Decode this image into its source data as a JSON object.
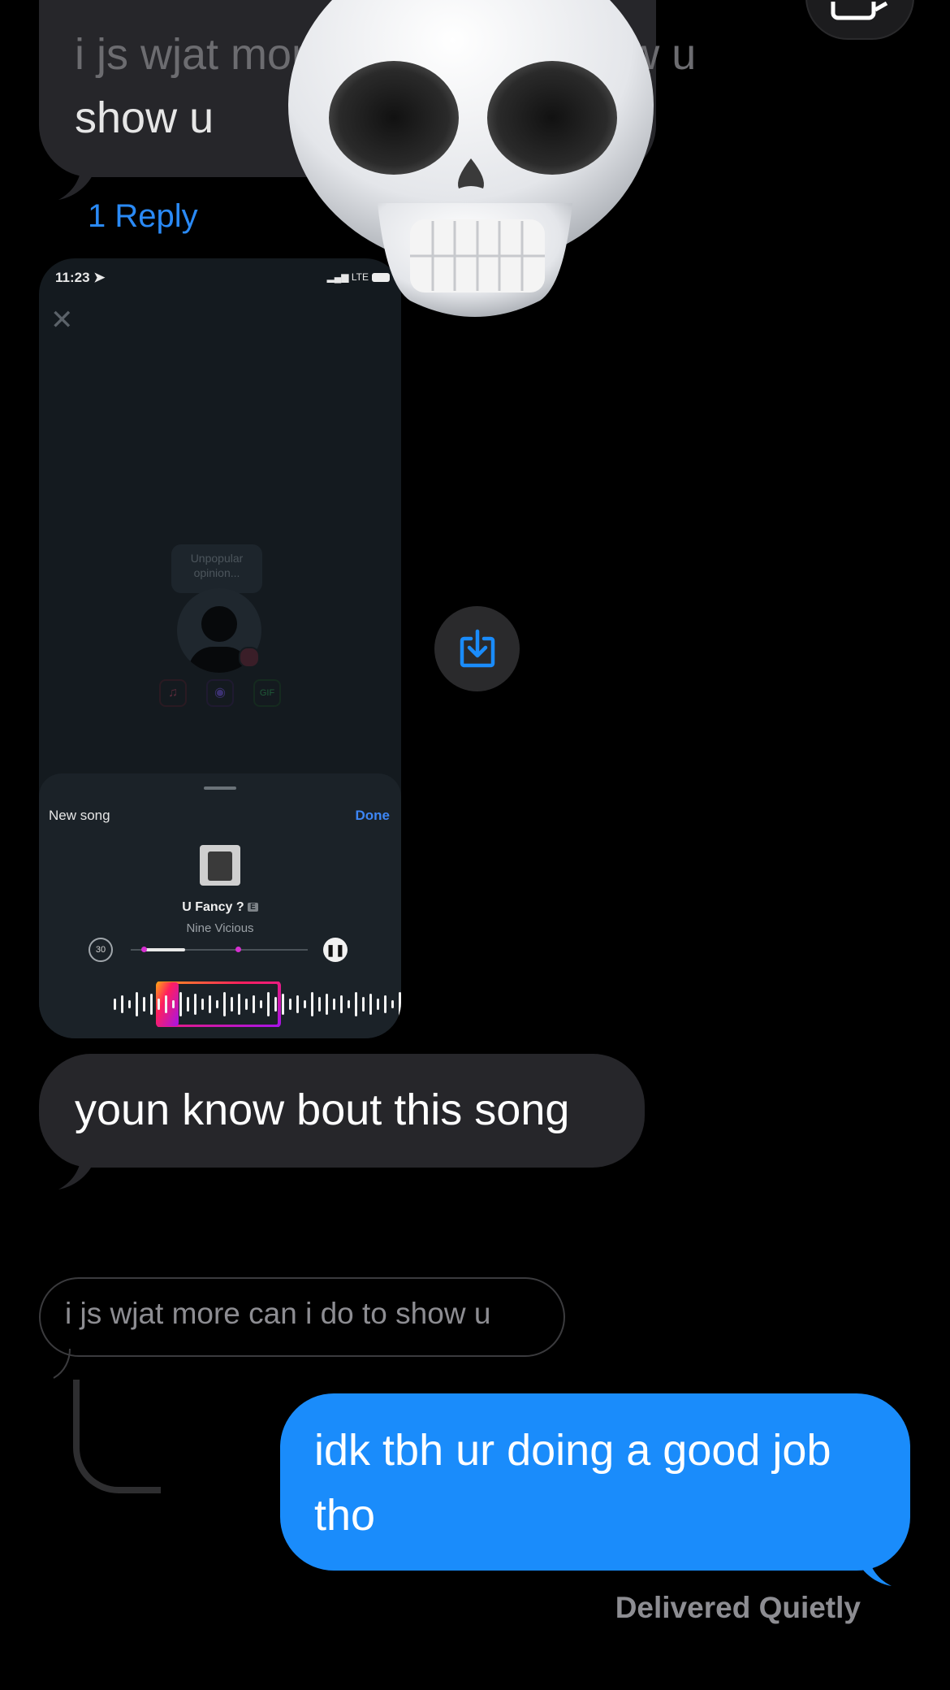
{
  "thread": {
    "clipped_message": {
      "line1": "i js wjat more can i do to show u",
      "line2": "show u"
    },
    "reply_count_label": "1 Reply",
    "attachment": {
      "status_time": "11:23",
      "status_network": "LTE",
      "placeholder_text": "Unpopular opinion...",
      "sheet": {
        "title": "New song",
        "done_label": "Done",
        "song_title": "U Fancy ?",
        "explicit_badge": "E",
        "artist": "Nine Vicious",
        "skip_label": "30"
      }
    },
    "incoming_message": "youn know bout this song",
    "quoted_message": "i js wjat more can i do to show u",
    "outgoing_message": "idk tbh ur doing a good job tho",
    "delivery_status": "Delivered Quietly"
  },
  "reaction": {
    "icon": "skull-memoji-icon"
  },
  "actions": {
    "save_icon": "download-icon"
  },
  "colors": {
    "background": "#000000",
    "incoming_bubble": "#26262a",
    "outgoing_bubble": "#1a8cfb",
    "link": "#2a8af6",
    "muted": "#8d8d92"
  }
}
